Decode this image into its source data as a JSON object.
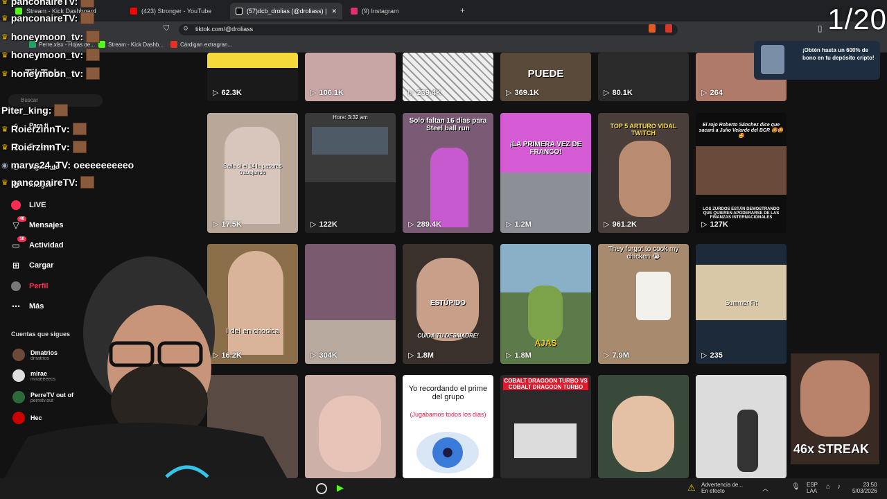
{
  "browser": {
    "tabs": [
      {
        "label": "Stream - Kick Dashboard",
        "color": "#53fc18"
      },
      {
        "label": "(423) Stronger - YouTube",
        "color": "#ff0000"
      },
      {
        "label": "(57)dcb_drolias (@droliass) | TikTok",
        "color": "#ffffff"
      },
      {
        "label": "(9) Instagram",
        "color": "#e1306c"
      }
    ],
    "new_tab": "+",
    "url": "tiktok.com/@droliass",
    "bookmarks": [
      "Perre.xlsx - Hojas de...",
      "Stream - Kick Dashb...",
      "Cárdigan extragran..."
    ]
  },
  "sidebar": {
    "logo": "TikTok",
    "search_placeholder": "Buscar",
    "nav": [
      {
        "label": "Para ti",
        "icon": "home-icon"
      },
      {
        "label": "Explorar",
        "icon": "compass-icon"
      },
      {
        "label": "Siguiendo",
        "icon": "following-icon"
      },
      {
        "label": "Amigos",
        "icon": "friends-icon"
      },
      {
        "label": "LIVE",
        "icon": "live-icon"
      },
      {
        "label": "Mensajes",
        "icon": "message-icon",
        "badge": "48"
      },
      {
        "label": "Actividad",
        "icon": "activity-icon",
        "badge": "10"
      },
      {
        "label": "Cargar",
        "icon": "upload-icon"
      },
      {
        "label": "Perfil",
        "icon": "profile-icon"
      },
      {
        "label": "Más",
        "icon": "more-icon"
      }
    ],
    "following_title": "Cuentas que sigues",
    "following": [
      {
        "name": "Dmatrios",
        "handle": "dmatrios"
      },
      {
        "name": "mirae",
        "handle": "miraeeeecs"
      },
      {
        "name": "PerreTV out of",
        "handle": "perretv.out"
      },
      {
        "name": "Hec",
        "handle": ""
      }
    ]
  },
  "chat": [
    {
      "user": "panconaireTV:",
      "msg": ""
    },
    {
      "user": "panconaireTV:",
      "msg": ""
    },
    {
      "user": "honeymoon_tv:",
      "msg": ""
    },
    {
      "user": "honeymoon_tv:",
      "msg": ""
    },
    {
      "user": "honeymoon_tv:",
      "msg": ""
    },
    {
      "user": "Piter_king:",
      "msg": ""
    },
    {
      "user": "RoierzinnTv:",
      "msg": ""
    },
    {
      "user": "RoierzinnTv:",
      "msg": ""
    },
    {
      "user": "marvs24_TV:",
      "msg": "oeeeeeeeeeo"
    },
    {
      "user": "panconaireTV:",
      "msg": ""
    }
  ],
  "grid": {
    "row1": [
      "62.3K",
      "106.1K",
      "239.4K",
      "369.1K",
      "80.1K",
      "264"
    ],
    "row1_caption": "PUEDE",
    "row2": [
      {
        "views": "17.5K",
        "caption": "Baila si el 14 la pasaras trabajando"
      },
      {
        "views": "122K",
        "caption": "Hora: 3:32 am"
      },
      {
        "views": "289.4K",
        "caption": "Solo faltan 16 dias para Steel ball run"
      },
      {
        "views": "1.2M",
        "caption": "¡LA PRIMERA VEZ DE FRANCO!"
      },
      {
        "views": "961.2K",
        "caption": "TOP 5 ARTURO VIDAL TWITCH"
      },
      {
        "views": "127K",
        "caption": "El rojo Roberto Sánchez dice que sacará a Julio Velarde del BCR 🤩🤩🤩"
      }
    ],
    "row3": [
      {
        "views": "16.2K",
        "caption": "I del en chosica"
      },
      {
        "views": "304K",
        "caption": ""
      },
      {
        "views": "1.8M",
        "caption": "ESTÚPIDO"
      },
      {
        "views": "1.8M",
        "caption": "AJAS"
      },
      {
        "views": "7.9M",
        "caption": "They forgot to cook my chicken 😭"
      },
      {
        "views": "235",
        "caption": "Summer Fit"
      }
    ],
    "row4_captions": [
      "",
      "",
      "Yo recordando el prime del grupo",
      "COBALT DRAGOON TURBO VS COBALT DRAGOON TURBO",
      "",
      ""
    ],
    "row4_sub": "(Jugabamos todos los dias)",
    "cuida": "CUIDA TU DESMADRE!",
    "zurdos": "LOS ZURDOS ESTÁN DEMOSTRANDO QUE QUIEREN APODERARSE DE LAS FINANZAS INTERNACIONALES"
  },
  "overlay": {
    "counter": "1/20",
    "promo": "¡Obtén hasta un 600% de bono en tu depósito cripto!",
    "streak": "46x STREAK"
  },
  "taskbar": {
    "notification_title": "Advertencia de...",
    "notification_sub": "En efecto",
    "lang": "ESP",
    "lang2": "LAA",
    "time": "23:50",
    "date": "5/03/2026"
  },
  "colors": {
    "accent": "#fe2c55",
    "bg": "#121212",
    "chrome": "#35363a"
  }
}
